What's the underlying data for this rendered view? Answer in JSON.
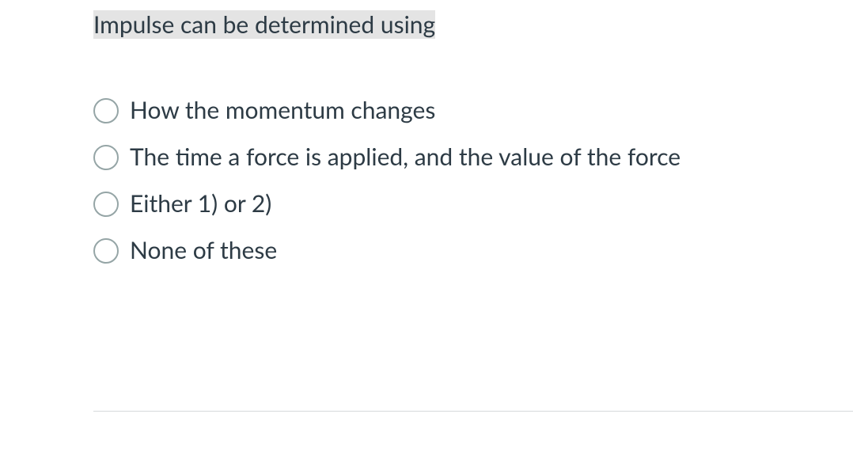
{
  "question": {
    "text": "Impulse can be determined using"
  },
  "options": [
    {
      "label": "How the momentum changes"
    },
    {
      "label": "The time a force is applied, and the value of the force"
    },
    {
      "label": "Either 1) or 2)"
    },
    {
      "label": "None of these"
    }
  ]
}
